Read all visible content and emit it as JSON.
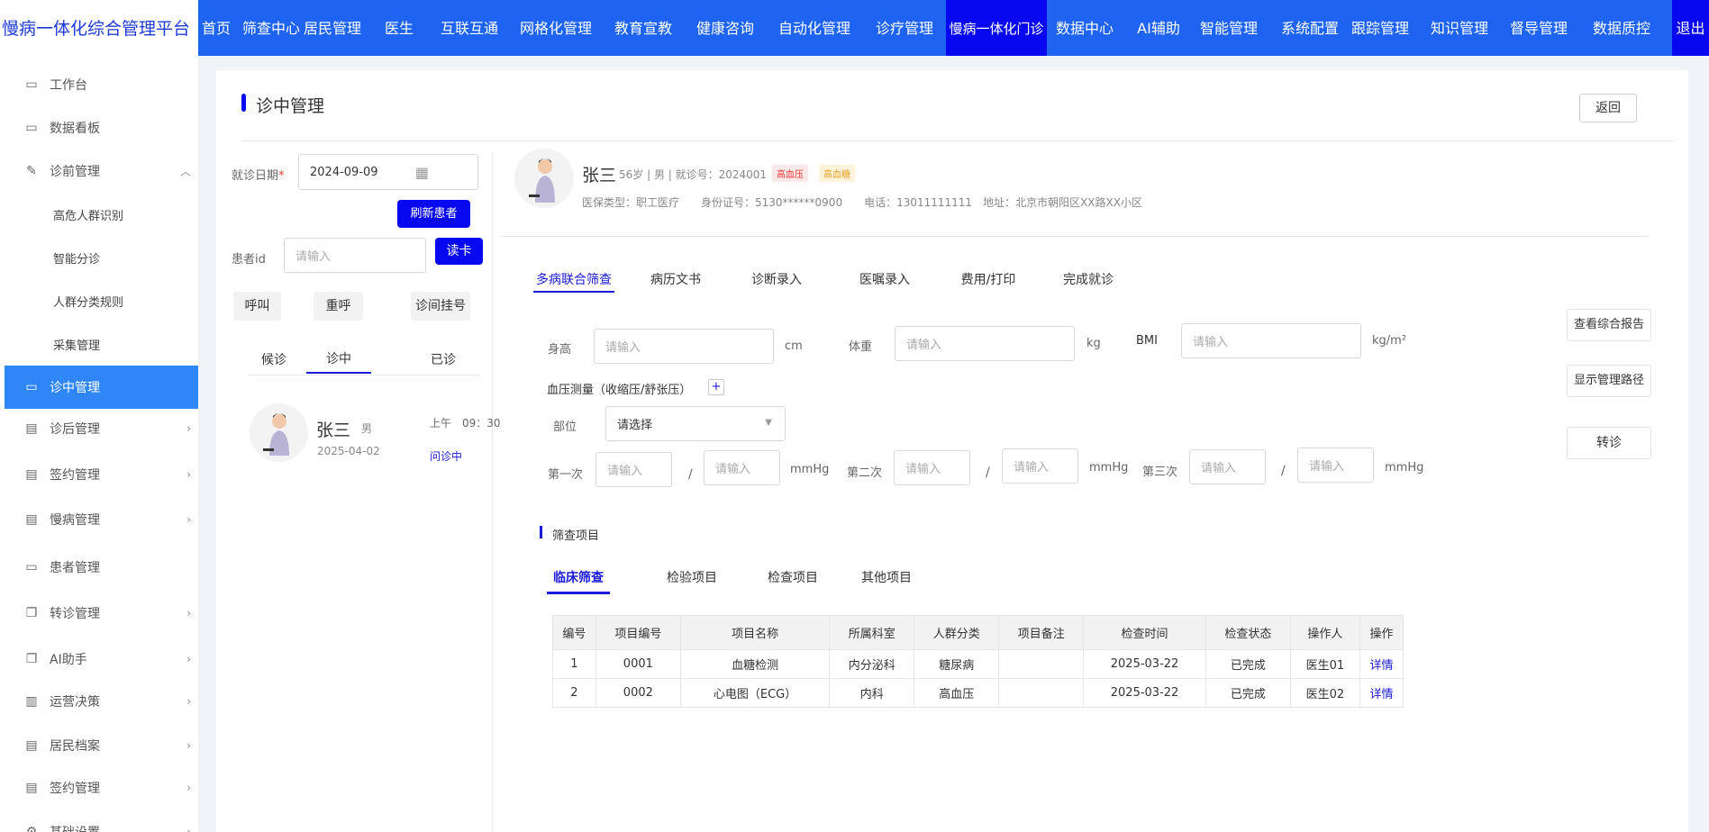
{
  "app": {
    "title": "慢病一体化综合管理平台"
  },
  "nav": {
    "items": [
      "首页",
      "筛查中心",
      "居民管理",
      "医生",
      "互联互通",
      "网格化管理",
      "教育宣教",
      "健康咨询",
      "自动化管理",
      "诊疗管理",
      "慢病一体化门诊",
      "数据中心",
      "AI辅助",
      "智能管理",
      "系统配置",
      "跟踪管理",
      "知识管理",
      "督导管理",
      "数据质控"
    ],
    "exit": "退出",
    "active": "慢病一体化门诊"
  },
  "sidebar": {
    "items": [
      {
        "label": "工作台",
        "icon": "monitor-icon"
      },
      {
        "label": "数据看板",
        "icon": "monitor-icon"
      },
      {
        "label": "诊前管理",
        "icon": "edit-icon"
      },
      {
        "label": "高危人群识别"
      },
      {
        "label": "智能分诊"
      },
      {
        "label": "人群分类规则"
      },
      {
        "label": "采集管理"
      },
      {
        "label": "诊中管理",
        "icon": "monitor-icon"
      },
      {
        "label": "诊后管理",
        "icon": "list-icon"
      },
      {
        "label": "签约管理",
        "icon": "list-icon"
      },
      {
        "label": "慢病管理",
        "icon": "list-icon"
      },
      {
        "label": "患者管理",
        "icon": "monitor-icon"
      },
      {
        "label": "转诊管理",
        "icon": "copy-icon"
      },
      {
        "label": "AI助手",
        "icon": "copy-icon"
      },
      {
        "label": "运营决策",
        "icon": "bar-chart-icon"
      },
      {
        "label": "居民档案",
        "icon": "list-icon"
      },
      {
        "label": "签约管理",
        "icon": "list-icon"
      },
      {
        "label": "基础设置",
        "icon": "gear-icon"
      }
    ],
    "active": "诊中管理"
  },
  "page": {
    "title": "诊中管理",
    "back": "返回"
  },
  "left": {
    "date_label": "就诊日期",
    "date_value": "2024-09-09",
    "refresh": "刷新患者",
    "pid_label": "患者id",
    "pid_placeholder": "请输入",
    "read_card": "读卡",
    "call": "呼叫",
    "recall": "重呼",
    "register": "诊间挂号",
    "tabs": [
      "候诊",
      "诊中",
      "已诊"
    ],
    "patient": {
      "name": "张三",
      "gender": "男",
      "time": "上午　09：30",
      "date": "2025-04-02",
      "status": "问诊中"
    }
  },
  "patient": {
    "name": "张三",
    "meta": "56岁 | 男 | 就诊号：2024001",
    "tags": [
      "高血压",
      "高血糖"
    ],
    "info": "医保类型：职工医疗　　身份证号：5130******0900　　电话：13011111111　地址：北京市朝阳区XX路XX小区"
  },
  "tabs": [
    "多病联合筛查",
    "病历文书",
    "诊断录入",
    "医嘱录入",
    "费用/打印",
    "完成就诊"
  ],
  "vitals": {
    "height_label": "身高",
    "height_unit": "cm",
    "weight_label": "体重",
    "weight_unit": "kg",
    "bmi_label": "BMI",
    "bmi_unit": "kg/m²",
    "placeholder": "请输入",
    "bp_label": "血压测量（收缩压/舒张压）",
    "plus": "+",
    "site_label": "部位",
    "site_value": "请选择",
    "first": "第一次",
    "second": "第二次",
    "third": "第三次",
    "mmhg": "mmHg",
    "slash": "/"
  },
  "side_buttons": [
    "查看综合报告",
    "显示管理路径",
    "转诊"
  ],
  "screening": {
    "title": "筛查项目",
    "tabs": [
      "临床筛查",
      "检验项目",
      "检查项目",
      "其他项目"
    ],
    "columns": [
      "编号",
      "项目编号",
      "项目名称",
      "所属科室",
      "人群分类",
      "项目备注",
      "检查时间",
      "检查状态",
      "操作人",
      "操作"
    ],
    "rows": [
      [
        "1",
        "0001",
        "血糖检测",
        "内分泌科",
        "糖尿病",
        "",
        "2025-03-22",
        "已完成",
        "医生01",
        "详情"
      ],
      [
        "2",
        "0002",
        "心电图（ECG）",
        "内科",
        "高血压",
        "",
        "2025-03-22",
        "已完成",
        "医生02",
        "详情"
      ]
    ]
  },
  "colors": {
    "primary": "#1e64f0",
    "accent": "#0808f0",
    "active_side": "#2f86f6"
  }
}
